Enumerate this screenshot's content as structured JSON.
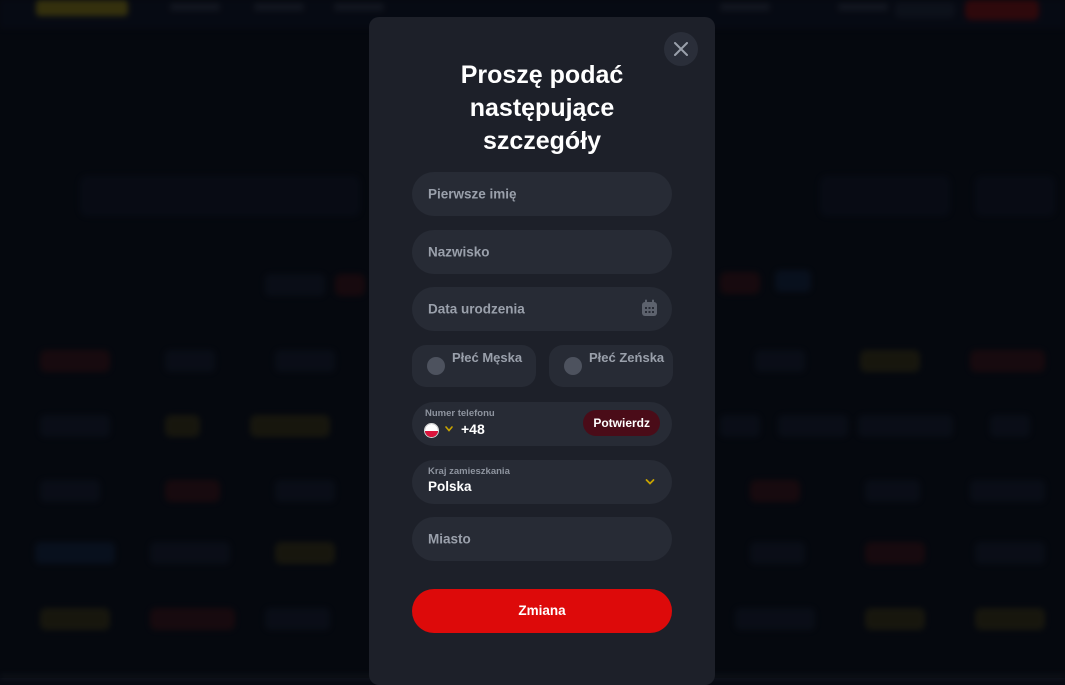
{
  "modal": {
    "title": "Proszę podać następujące szczegóły",
    "close_icon": "close-icon",
    "first_name_placeholder": "Pierwsze imię",
    "last_name_placeholder": "Nazwisko",
    "birth_date_placeholder": "Data urodzenia",
    "calendar_icon": "calendar-icon",
    "gender_male_label": "Płeć Męska",
    "gender_female_label": "Płeć Zeńska",
    "phone": {
      "label": "Numer telefonu",
      "country_flag": "flag-poland",
      "dial_code": "+48",
      "confirm_label": "Potwierdz"
    },
    "country": {
      "label": "Kraj zamieszkania",
      "value": "Polska"
    },
    "city_placeholder": "Miasto",
    "submit_label": "Zmiana"
  },
  "colors": {
    "modal_bg": "#1d2029",
    "field_bg": "#272b35",
    "primary_red": "#dd0a0a",
    "confirm_bg": "#4a0c18",
    "chevron_yellow": "#c8a400"
  }
}
